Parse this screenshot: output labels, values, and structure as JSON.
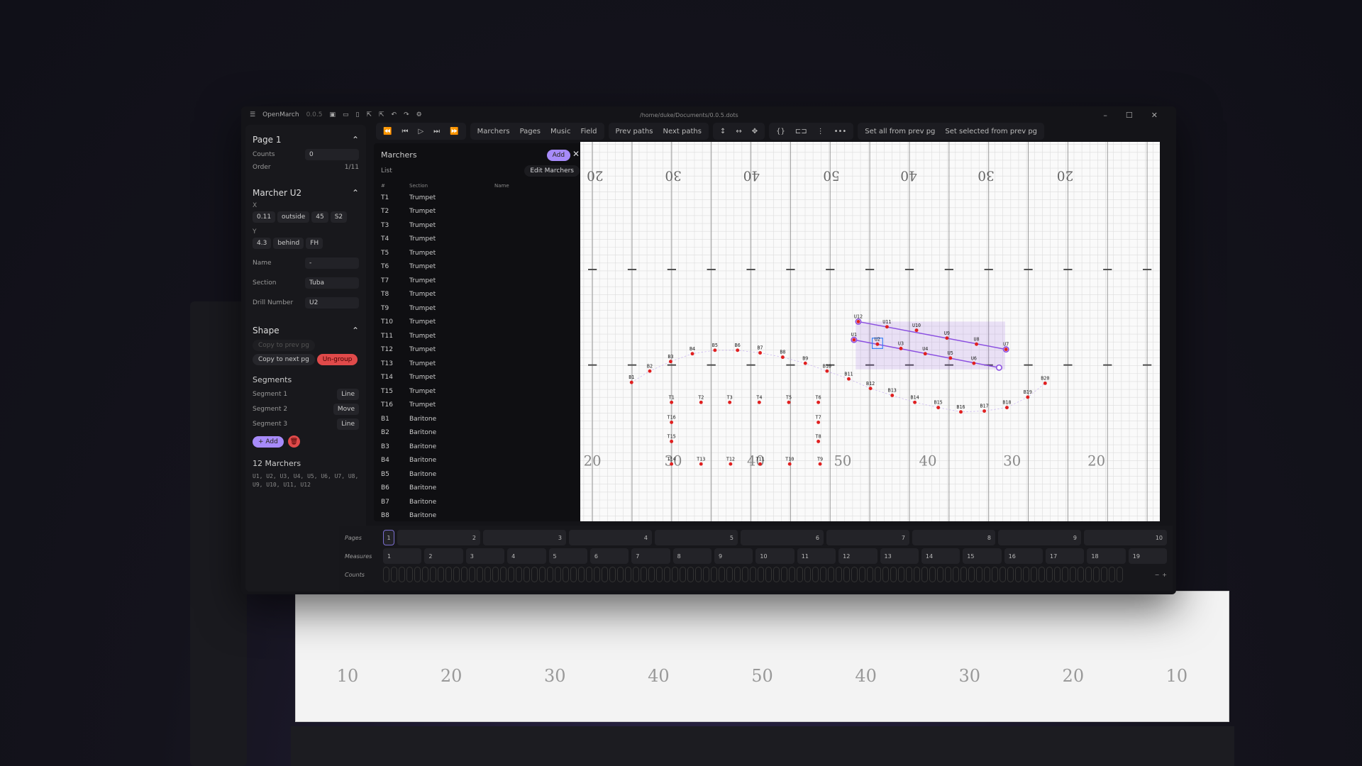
{
  "app": {
    "name": "OpenMarch",
    "version": "0.0.5",
    "file_path": "/home/duke/Documents/0.0.5.dots"
  },
  "toolbar": {
    "view_tabs": [
      "Marchers",
      "Pages",
      "Music",
      "Field"
    ],
    "paths": [
      "Prev paths",
      "Next paths"
    ],
    "set_all": "Set all from prev pg",
    "set_selected": "Set selected from prev pg"
  },
  "page_panel": {
    "title": "Page 1",
    "counts_label": "Counts",
    "counts_value": "0",
    "order_label": "Order",
    "order_value": "1/11"
  },
  "marcher_panel": {
    "title": "Marcher U2",
    "x_label": "X",
    "x_values": [
      "0.11",
      "outside",
      "45",
      "S2"
    ],
    "y_label": "Y",
    "y_values": [
      "4.3",
      "behind",
      "FH"
    ],
    "name_label": "Name",
    "name_value": "-",
    "section_label": "Section",
    "section_value": "Tuba",
    "drill_label": "Drill Number",
    "drill_value": "U2"
  },
  "shape_panel": {
    "title": "Shape",
    "copy_prev": "Copy to prev pg",
    "copy_next": "Copy to next pg",
    "ungroup": "Un-group",
    "segments_title": "Segments",
    "segments": [
      {
        "label": "Segment 1",
        "type": "Line"
      },
      {
        "label": "Segment 2",
        "type": "Move"
      },
      {
        "label": "Segment 3",
        "type": "Line"
      }
    ],
    "add": "+ Add",
    "count_title": "12 Marchers",
    "marcher_ids": "U1, U2, U3, U4, U5, U6, U7, U8, U9, U10, U11, U12"
  },
  "marchers_list": {
    "title": "Marchers",
    "add": "Add",
    "list_label": "List",
    "edit": "Edit Marchers",
    "columns": [
      "#",
      "Section",
      "Name"
    ],
    "rows": [
      [
        "T1",
        "Trumpet"
      ],
      [
        "T2",
        "Trumpet"
      ],
      [
        "T3",
        "Trumpet"
      ],
      [
        "T4",
        "Trumpet"
      ],
      [
        "T5",
        "Trumpet"
      ],
      [
        "T6",
        "Trumpet"
      ],
      [
        "T7",
        "Trumpet"
      ],
      [
        "T8",
        "Trumpet"
      ],
      [
        "T9",
        "Trumpet"
      ],
      [
        "T10",
        "Trumpet"
      ],
      [
        "T11",
        "Trumpet"
      ],
      [
        "T12",
        "Trumpet"
      ],
      [
        "T13",
        "Trumpet"
      ],
      [
        "T14",
        "Trumpet"
      ],
      [
        "T15",
        "Trumpet"
      ],
      [
        "T16",
        "Trumpet"
      ],
      [
        "B1",
        "Baritone"
      ],
      [
        "B2",
        "Baritone"
      ],
      [
        "B3",
        "Baritone"
      ],
      [
        "B4",
        "Baritone"
      ],
      [
        "B5",
        "Baritone"
      ],
      [
        "B6",
        "Baritone"
      ],
      [
        "B7",
        "Baritone"
      ],
      [
        "B8",
        "Baritone"
      ]
    ]
  },
  "field": {
    "top_labels": [
      "20",
      "30",
      "40",
      "50",
      "40",
      "30",
      "20"
    ],
    "bottom_labels": [
      "20",
      "30",
      "40",
      "50",
      "40",
      "30",
      "20"
    ],
    "back_labels": [
      "10",
      "20",
      "30",
      "40",
      "50",
      "40",
      "30",
      "20",
      "10"
    ],
    "marker_color": "#e02020",
    "selection_color": "#8b4fe0"
  },
  "timeline": {
    "pages_label": "Pages",
    "measures_label": "Measures",
    "counts_label": "Counts",
    "pages": [
      "1",
      "2",
      "3",
      "4",
      "5",
      "6",
      "7",
      "8",
      "9",
      "10"
    ],
    "measures": [
      "1",
      "2",
      "3",
      "4",
      "5",
      "6",
      "7",
      "8",
      "9",
      "10",
      "11",
      "12",
      "13",
      "14",
      "15",
      "16",
      "17",
      "18",
      "19"
    ]
  }
}
